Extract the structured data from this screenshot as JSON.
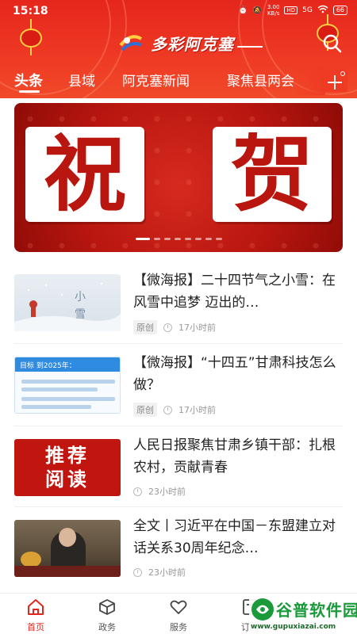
{
  "status_bar": {
    "time": "15:18",
    "net_speed_value": "3.00",
    "net_speed_unit": "KB/s",
    "hd_label": "HD",
    "signal_label": "5G",
    "battery": "66"
  },
  "header": {
    "app_title": "多彩阿克塞",
    "search_icon": "search-icon"
  },
  "tabs": [
    {
      "label": "头条",
      "active": true
    },
    {
      "label": "县域",
      "active": false
    },
    {
      "label": "阿克塞新闻",
      "active": false
    },
    {
      "label": "聚焦县两会",
      "active": false
    }
  ],
  "banner": {
    "char1": "祝",
    "char2": "贺",
    "slide_count": 8,
    "active_slide": 0
  },
  "news": [
    {
      "title": "【微海报】二十四节气之小雪：在风雪中追梦 迈出的…",
      "tag": "原创",
      "time": "17小时前",
      "thumb_text": "小\n雪"
    },
    {
      "title": "【微海报】“十四五”甘肃科技怎么做？",
      "tag": "原创",
      "time": "17小时前",
      "thumb_header": "目标 到2025年："
    },
    {
      "title": "人民日报聚焦甘肃乡镇干部：扎根农村，贡献青春",
      "tag": "",
      "time": "23小时前",
      "thumb_line1": "推荐",
      "thumb_line2": "阅读"
    },
    {
      "title": "全文丨习近平在中国－东盟建立对话关系30周年纪念…",
      "tag": "",
      "time": "23小时前"
    }
  ],
  "bottom_nav": [
    {
      "label": "首页",
      "icon": "home-icon",
      "active": true
    },
    {
      "label": "政务",
      "icon": "cube-icon",
      "active": false
    },
    {
      "label": "服务",
      "icon": "heart-icon",
      "active": false
    },
    {
      "label": "订阅",
      "icon": "subscribe-icon",
      "active": false
    }
  ],
  "watermark": {
    "title": "谷普软件园",
    "url": "www.gupuxiazai.com"
  },
  "colors": {
    "brand_red": "#e5261c",
    "text": "#222222",
    "meta": "#999999"
  }
}
